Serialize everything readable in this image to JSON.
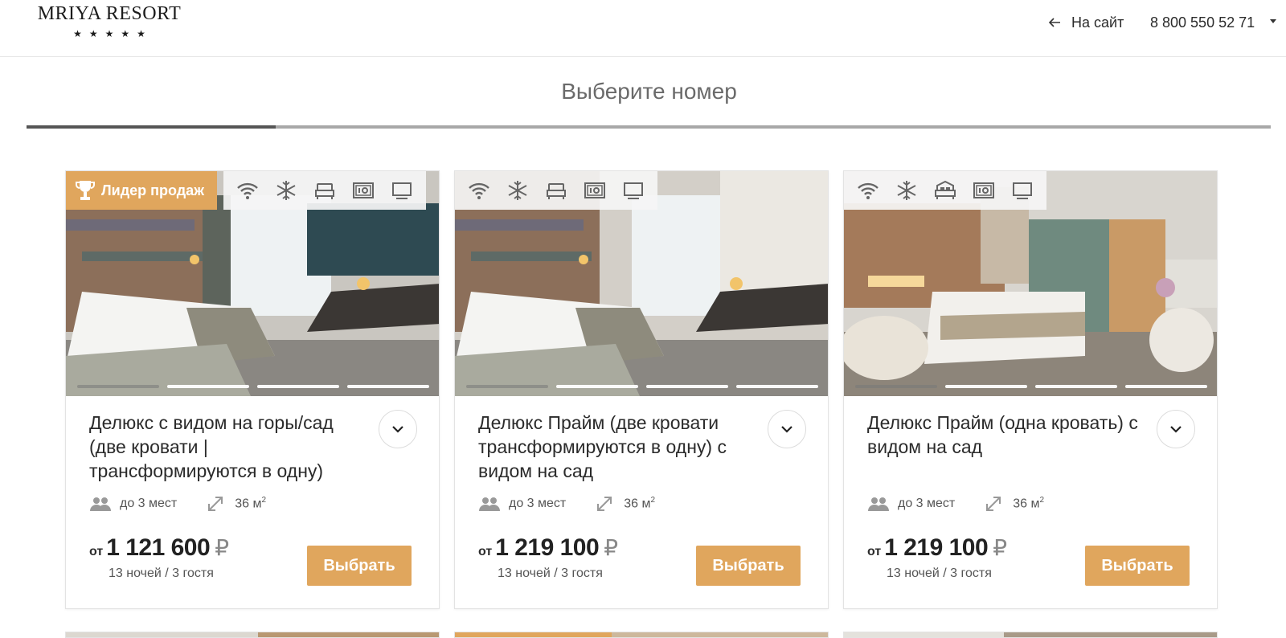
{
  "header": {
    "logo_text": "MRIYA RESORT",
    "logo_stars": "★★★★★",
    "back_label": "На сайт",
    "phone": "8 800 550 52 71"
  },
  "page": {
    "title": "Выберите номер",
    "progress_fraction": 0.2
  },
  "colors": {
    "accent": "#e0a65d",
    "text": "#2b2b2b",
    "muted": "#555555"
  },
  "cards": [
    {
      "badge": "Лидер продаж",
      "amenities": [
        "wifi-icon",
        "snowflake-icon",
        "bed-icon",
        "safe-icon",
        "tv-icon"
      ],
      "name": "Делюкс с видом на горы/сад (две кровати | трансформируются в одну)",
      "guests": "до 3 мест",
      "area": "36 м",
      "area_unit_sup": "2",
      "price_from": "от",
      "price": "1 121 600",
      "currency": "₽",
      "nights": "13 ночей / 3 гостя",
      "button": "Выбрать"
    },
    {
      "badge": "",
      "amenities": [
        "wifi-icon",
        "snowflake-icon",
        "bed-icon",
        "safe-icon",
        "tv-icon"
      ],
      "name": "Делюкс Прайм (две кровати трансформируются в одну) с видом на сад",
      "guests": "до 3 мест",
      "area": "36 м",
      "area_unit_sup": "2",
      "price_from": "от",
      "price": "1 219 100",
      "currency": "₽",
      "nights": "13 ночей / 3 гостя",
      "button": "Выбрать"
    },
    {
      "badge": "",
      "amenities": [
        "wifi-icon",
        "snowflake-icon",
        "double-bed-icon",
        "safe-icon",
        "tv-icon"
      ],
      "name": "Делюкс Прайм (одна кровать) с видом на сад",
      "guests": "до 3 мест",
      "area": "36 м",
      "area_unit_sup": "2",
      "price_from": "от",
      "price": "1 219 100",
      "currency": "₽",
      "nights": "13 ночей / 3 гостя",
      "button": "Выбрать"
    }
  ]
}
